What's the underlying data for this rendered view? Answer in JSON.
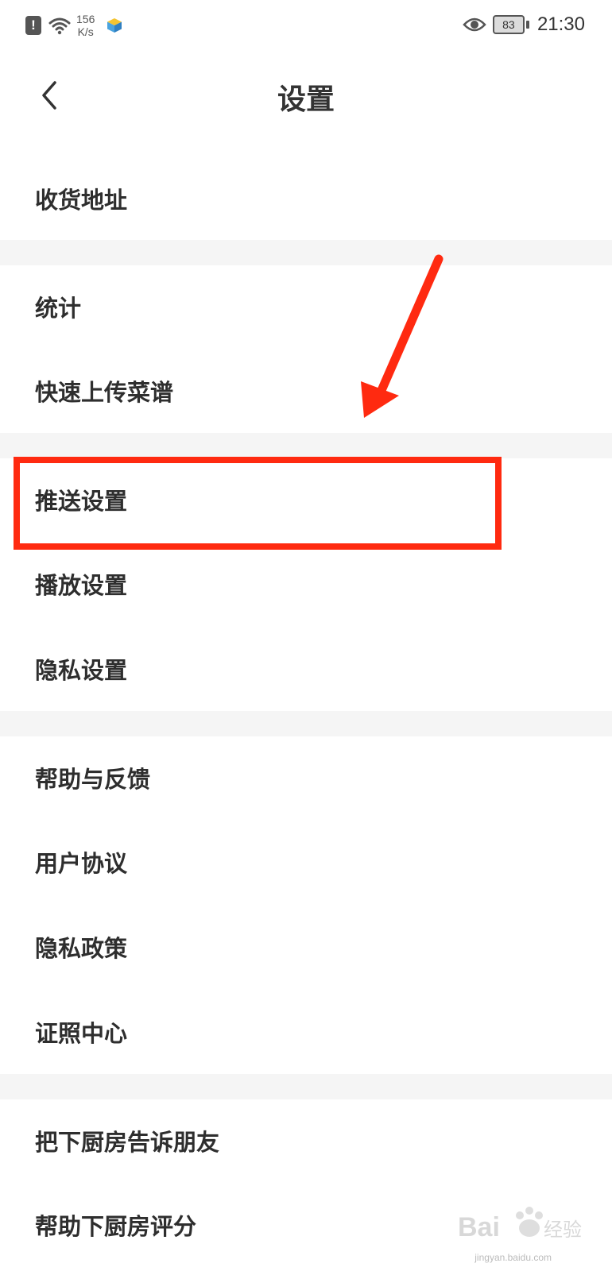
{
  "status_bar": {
    "net_speed_value": "156",
    "net_speed_unit": "K/s",
    "battery_level": "83",
    "time": "21:30",
    "icons": [
      "alert-icon",
      "wifi-icon",
      "cube-icon",
      "eye-icon",
      "battery-icon"
    ]
  },
  "nav": {
    "title": "设置",
    "back_icon": "chevron-left-icon"
  },
  "groups": [
    {
      "items": [
        "收货地址"
      ]
    },
    {
      "items": [
        "统计",
        "快速上传菜谱"
      ]
    },
    {
      "items": [
        "推送设置",
        "播放设置",
        "隐私设置"
      ]
    },
    {
      "items": [
        "帮助与反馈",
        "用户协议",
        "隐私政策",
        "证照中心"
      ]
    },
    {
      "items": [
        "把下厨房告诉朋友",
        "帮助下厨房评分"
      ]
    }
  ],
  "annotation": {
    "highlighted_item": "推送设置",
    "color": "#ff2a10"
  },
  "watermark": {
    "text": "Baidu经验",
    "sub": "jingyan.baidu.com"
  },
  "colors": {
    "background": "#ffffff",
    "separator": "#f5f5f5",
    "text": "#2e2e2e"
  }
}
